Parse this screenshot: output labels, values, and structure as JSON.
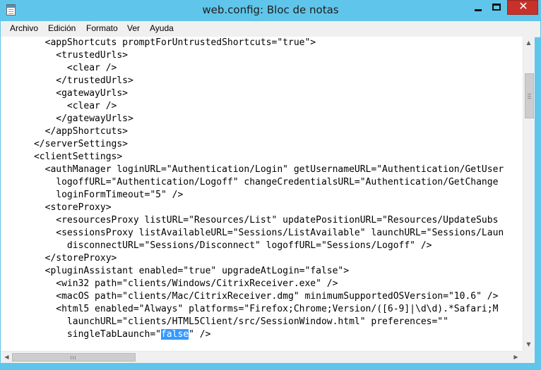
{
  "window": {
    "title": "web.config: Bloc de notas",
    "close_symbol": "✕"
  },
  "icons": {
    "app": "notepad-icon",
    "minimize": "minimize-icon",
    "maximize": "maximize-icon",
    "close": "close-icon"
  },
  "colors": {
    "title_bar": "#60c5ea",
    "close_button": "#c7312a",
    "selection": "#3399ff"
  },
  "menu": {
    "items": [
      "Archivo",
      "Edición",
      "Formato",
      "Ver",
      "Ayuda"
    ]
  },
  "editor": {
    "lines": [
      "        <appShortcuts promptForUntrustedShortcuts=\"true\">",
      "          <trustedUrls>",
      "            <clear />",
      "          </trustedUrls>",
      "          <gatewayUrls>",
      "            <clear />",
      "          </gatewayUrls>",
      "        </appShortcuts>",
      "      </serverSettings>",
      "      <clientSettings>",
      "        <authManager loginURL=\"Authentication/Login\" getUsernameURL=\"Authentication/GetUser",
      "          logoffURL=\"Authentication/Logoff\" changeCredentialsURL=\"Authentication/GetChange",
      "          loginFormTimeout=\"5\" />",
      "        <storeProxy>",
      "          <resourcesProxy listURL=\"Resources/List\" updatePositionURL=\"Resources/UpdateSubs",
      "          <sessionsProxy listAvailableURL=\"Sessions/ListAvailable\" launchURL=\"Sessions/Laun",
      "            disconnectURL=\"Sessions/Disconnect\" logoffURL=\"Sessions/Logoff\" />",
      "        </storeProxy>",
      "        <pluginAssistant enabled=\"true\" upgradeAtLogin=\"false\">",
      "          <win32 path=\"clients/Windows/CitrixReceiver.exe\" />",
      "          <macOS path=\"clients/Mac/CitrixReceiver.dmg\" minimumSupportedOSVersion=\"10.6\" />",
      "          <html5 enabled=\"Always\" platforms=\"Firefox;Chrome;Version/([6-9]|\\d\\d).*Safari;M",
      "            launchURL=\"clients/HTML5Client/src/SessionWindow.html\" preferences=\"\"",
      "            singleTabLaunch=\""
    ],
    "selected_text": "false",
    "last_line_suffix": "\" />"
  },
  "scrollbars": {
    "up_arrow": "▲",
    "down_arrow": "▼",
    "left_arrow": "◀",
    "right_arrow": "▶"
  }
}
